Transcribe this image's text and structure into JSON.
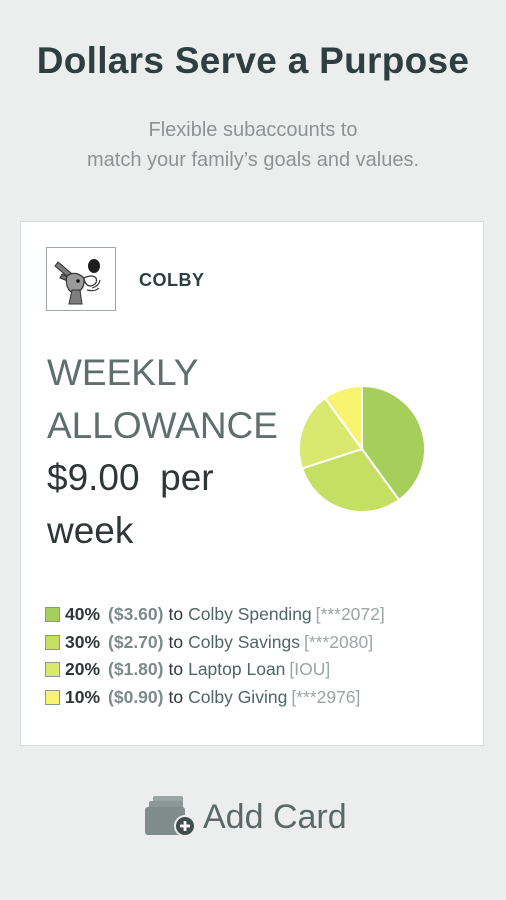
{
  "header": {
    "title": "Dollars Serve a Purpose",
    "subtitle_line1": "Flexible subaccounts to",
    "subtitle_line2": "match your family’s goals and values."
  },
  "card": {
    "owner_name": "COLBY",
    "avatar_icon": "donkey-icon",
    "allowance_title_line1": "WEEKLY",
    "allowance_title_line2": "ALLOWANCE",
    "allowance_amount_line1": "$9.00  per",
    "allowance_amount_line2": "week",
    "allocations": [
      {
        "percent": "40%",
        "amount": "($3.60)",
        "to": "to",
        "target": "Colby Spending",
        "account": "[***2072]",
        "color": "#a5cf5a",
        "value": 40
      },
      {
        "percent": "30%",
        "amount": "($2.70)",
        "to": "to",
        "target": "Colby Savings",
        "account": "[***2080]",
        "color": "#c4df62",
        "value": 30
      },
      {
        "percent": "20%",
        "amount": "($1.80)",
        "to": "to",
        "target": "Laptop Loan",
        "account": "[IOU]",
        "color": "#d9e970",
        "value": 20
      },
      {
        "percent": "10%",
        "amount": "($0.90)",
        "to": "to",
        "target": "Colby Giving",
        "account": "[***2976]",
        "color": "#f8f46f",
        "value": 10
      }
    ]
  },
  "footer": {
    "add_card_label": "Add Card",
    "add_card_icon": "add-card-icon"
  },
  "chart_data": {
    "type": "pie",
    "categories": [
      "Colby Spending",
      "Colby Savings",
      "Laptop Loan",
      "Colby Giving"
    ],
    "values": [
      40,
      30,
      20,
      10
    ],
    "colors": [
      "#a5cf5a",
      "#c4df62",
      "#d9e970",
      "#f8f46f"
    ]
  }
}
